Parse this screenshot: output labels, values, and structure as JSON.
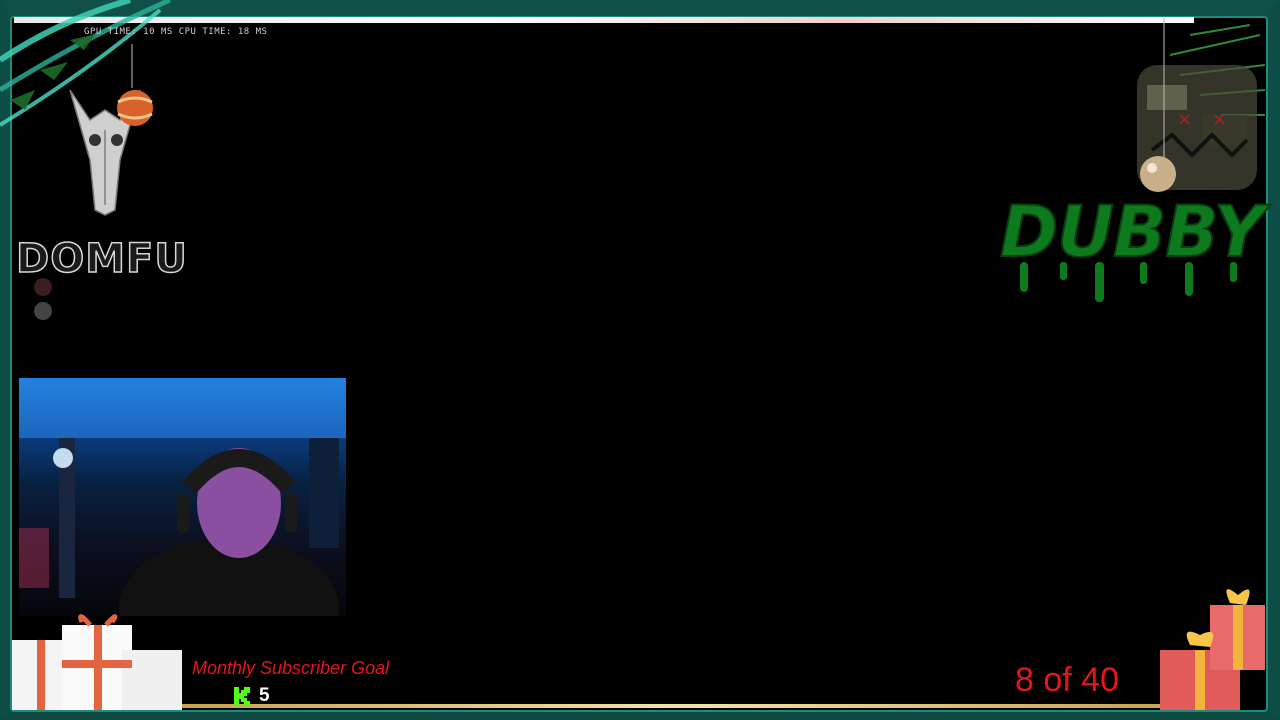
{
  "overlay": {
    "perf_stats": "GPU TIME: 10 MS CPU TIME: 18 MS",
    "left_logo_text": "DOMFU",
    "right_logo_text": "DUBBY"
  },
  "subscriber_goal": {
    "label": "Monthly Subscriber Goal",
    "current_count": "5",
    "progress_text": "8 of 40",
    "icon": "kick-icon"
  },
  "colors": {
    "frame": "#0e4d45",
    "goal_text": "#e8141b",
    "dubby_logo": "#0e7a1e",
    "kick_green": "#53fc18"
  }
}
